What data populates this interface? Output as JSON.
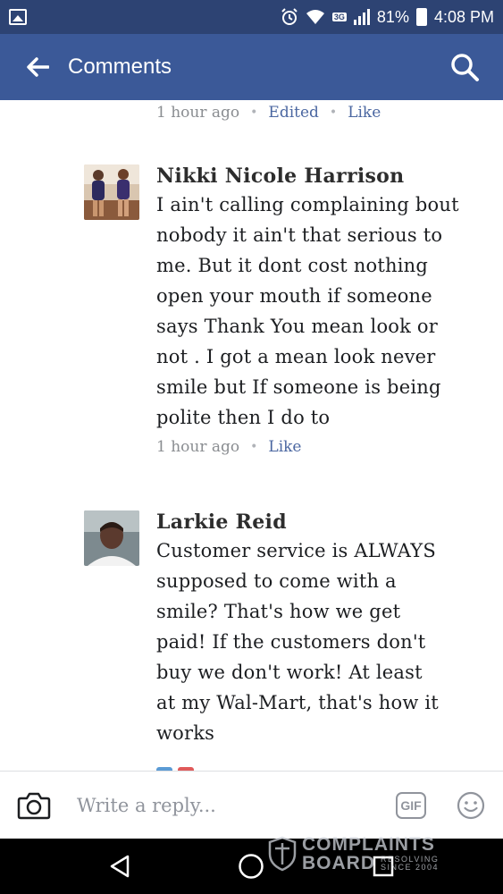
{
  "status_bar": {
    "network": "3G",
    "battery": "81%",
    "time": "4:08 PM"
  },
  "header": {
    "title": "Comments"
  },
  "previous_comment_meta": {
    "time": "1 hour ago",
    "edited": "Edited",
    "like": "Like"
  },
  "comments": [
    {
      "author": "Nikki Nicole Harrison",
      "lines": [
        "I ain't calling complaining bout",
        "nobody it ain't that serious to",
        "me. But it dont cost nothing",
        "open your mouth if someone",
        "says Thank You mean look or",
        "not . I got a mean look never",
        "smile but If someone is being",
        "polite then I do to"
      ],
      "time": "1 hour ago",
      "like": "Like"
    },
    {
      "author": "Larkie Reid",
      "lines": [
        "Customer service is ALWAYS",
        "supposed to come with a",
        "smile? That's how we get",
        "paid! If the customers don't",
        "buy we don't work! At least",
        "at my Wal-Mart, that's how it",
        "works"
      ]
    }
  ],
  "reply_bar": {
    "placeholder": "Write a reply...",
    "gif_label": "GIF"
  },
  "watermark": {
    "line1": "COMPLAINTS",
    "line2": "BOARD",
    "tag1": "RESOLVING",
    "tag2": "SINCE 2004"
  },
  "colors": {
    "status_bar": "#2d4373",
    "app_bar": "#3b5998",
    "link": "#4b67a1",
    "meta": "#8a8d91"
  }
}
